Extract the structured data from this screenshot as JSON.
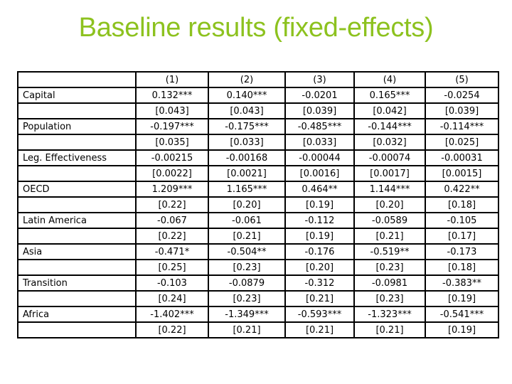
{
  "slide": {
    "title": "Baseline results (fixed-effects)",
    "title_color": "#8dc21f"
  },
  "table": {
    "columns": [
      "",
      "(1)",
      "(2)",
      "(3)",
      "(4)",
      "(5)"
    ],
    "rows": [
      {
        "label": "Capital",
        "coef": [
          "0.132***",
          "0.140***",
          "-0.0201",
          "0.165***",
          "-0.0254"
        ],
        "se": [
          "[0.043]",
          "[0.043]",
          "[0.039]",
          "[0.042]",
          "[0.039]"
        ]
      },
      {
        "label": "Population",
        "coef": [
          "-0.197***",
          "-0.175***",
          "-0.485***",
          "-0.144***",
          "-0.114***"
        ],
        "se": [
          "[0.035]",
          "[0.033]",
          "[0.033]",
          "[0.032]",
          "[0.025]"
        ]
      },
      {
        "label": "Leg. Effectiveness",
        "coef": [
          "-0.00215",
          "-0.00168",
          "-0.00044",
          "-0.00074",
          "-0.00031"
        ],
        "se": [
          "[0.0022]",
          "[0.0021]",
          "[0.0016]",
          "[0.0017]",
          "[0.0015]"
        ]
      },
      {
        "label": "OECD",
        "coef": [
          "1.209***",
          "1.165***",
          "0.464**",
          "1.144***",
          "0.422**"
        ],
        "se": [
          "[0.22]",
          "[0.20]",
          "[0.19]",
          "[0.20]",
          "[0.18]"
        ]
      },
      {
        "label": "Latin America",
        "coef": [
          "-0.067",
          "-0.061",
          "-0.112",
          "-0.0589",
          "-0.105"
        ],
        "se": [
          "[0.22]",
          "[0.21]",
          "[0.19]",
          "[0.21]",
          "[0.17]"
        ]
      },
      {
        "label": "Asia",
        "coef": [
          "-0.471*",
          "-0.504**",
          "-0.176",
          "-0.519**",
          "-0.173"
        ],
        "se": [
          "[0.25]",
          "[0.23]",
          "[0.20]",
          "[0.23]",
          "[0.18]"
        ]
      },
      {
        "label": "Transition",
        "coef": [
          "-0.103",
          "-0.0879",
          "-0.312",
          "-0.0981",
          "-0.383**"
        ],
        "se": [
          "[0.24]",
          "[0.23]",
          "[0.21]",
          "[0.23]",
          "[0.19]"
        ]
      },
      {
        "label": "Africa",
        "coef": [
          "-1.402***",
          "-1.349***",
          "-0.593***",
          "-1.323***",
          "-0.541***"
        ],
        "se": [
          "[0.22]",
          "[0.21]",
          "[0.21]",
          "[0.21]",
          "[0.19]"
        ]
      }
    ]
  }
}
